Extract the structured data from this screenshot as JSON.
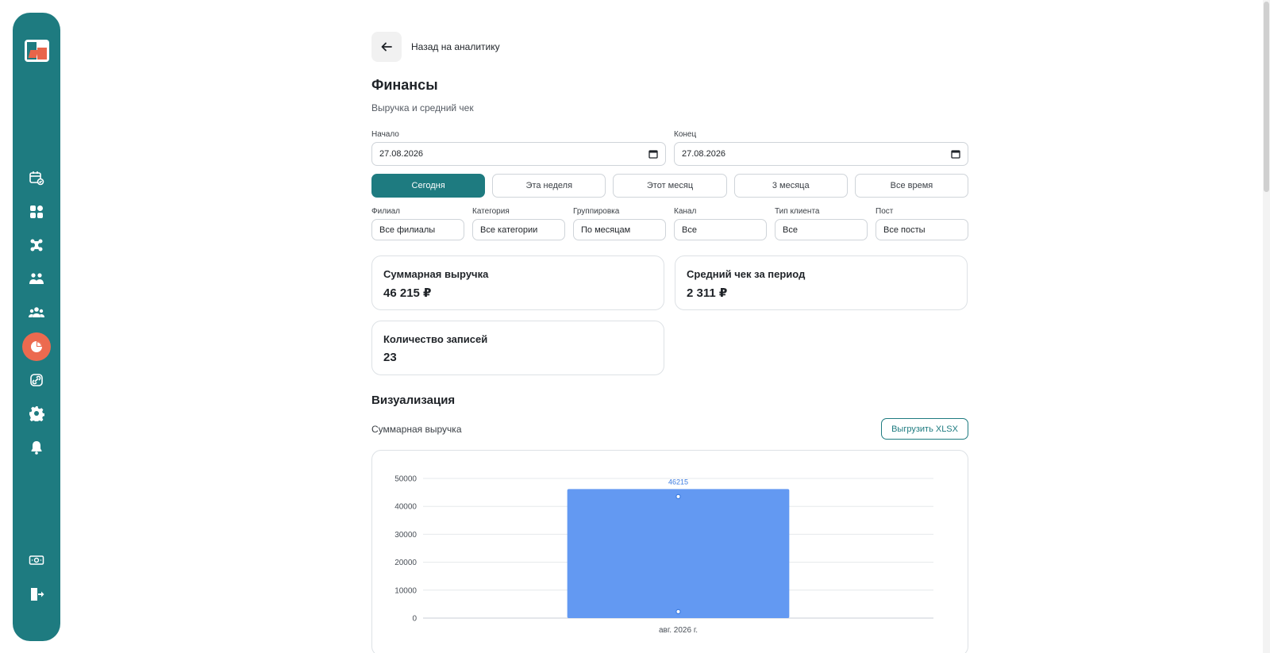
{
  "sidebar": {
    "logo_icon": "app-logo",
    "items": [
      {
        "icon": "calendar-check-icon"
      },
      {
        "icon": "apps-grid-icon"
      },
      {
        "icon": "team-network-icon"
      },
      {
        "icon": "handshake-icon"
      },
      {
        "icon": "users-group-icon"
      },
      {
        "icon": "pie-chart-icon",
        "active": true
      },
      {
        "icon": "link-icon"
      },
      {
        "icon": "gear-icon"
      },
      {
        "icon": "bell-icon"
      }
    ],
    "bottom": [
      {
        "icon": "cash-icon"
      },
      {
        "icon": "logout-icon"
      }
    ]
  },
  "header": {
    "back_label": "Назад на аналитику",
    "title": "Финансы",
    "subtitle": "Выручка и средний чек"
  },
  "dates": {
    "start_label": "Начало",
    "start_value": "27.08.2026",
    "end_label": "Конец",
    "end_value": "27.08.2026"
  },
  "periods": [
    "Сегодня",
    "Эта неделя",
    "Этот месяц",
    "3 месяца",
    "Все время"
  ],
  "active_period": "Сегодня",
  "filters": [
    {
      "label": "Филиал",
      "value": "Все филиалы"
    },
    {
      "label": "Категория",
      "value": "Все категории"
    },
    {
      "label": "Группировка",
      "value": "По месяцам"
    },
    {
      "label": "Канал",
      "value": "Все"
    },
    {
      "label": "Тип клиента",
      "value": "Все"
    },
    {
      "label": "Пост",
      "value": "Все посты"
    }
  ],
  "stats": {
    "revenue": {
      "label": "Суммарная выручка",
      "value": "46 215 ₽"
    },
    "avg_check": {
      "label": "Средний чек за период",
      "value": "2 311 ₽"
    },
    "count": {
      "label": "Количество записей",
      "value": "23"
    }
  },
  "visualization": {
    "title": "Визуализация",
    "subtitle": "Суммарная выручка",
    "export_label": "Выгрузить XLSX"
  },
  "colors": {
    "brand": "#1e7b80",
    "accent": "#ec6a4f",
    "bar": "#6399f2",
    "data_label": "#3b7be0"
  },
  "chart_data": {
    "type": "bar",
    "categories": [
      "авг. 2026 г."
    ],
    "series": [
      {
        "values": [
          46215
        ]
      },
      {
        "type": "line",
        "values": [
          43500
        ]
      },
      {
        "type": "line",
        "values": [
          2311
        ]
      }
    ],
    "data_labels": [
      "46215"
    ],
    "y_ticks": [
      "0",
      "10000",
      "20000",
      "30000",
      "40000",
      "50000"
    ],
    "ylim": [
      0,
      50000
    ],
    "grid": true
  }
}
